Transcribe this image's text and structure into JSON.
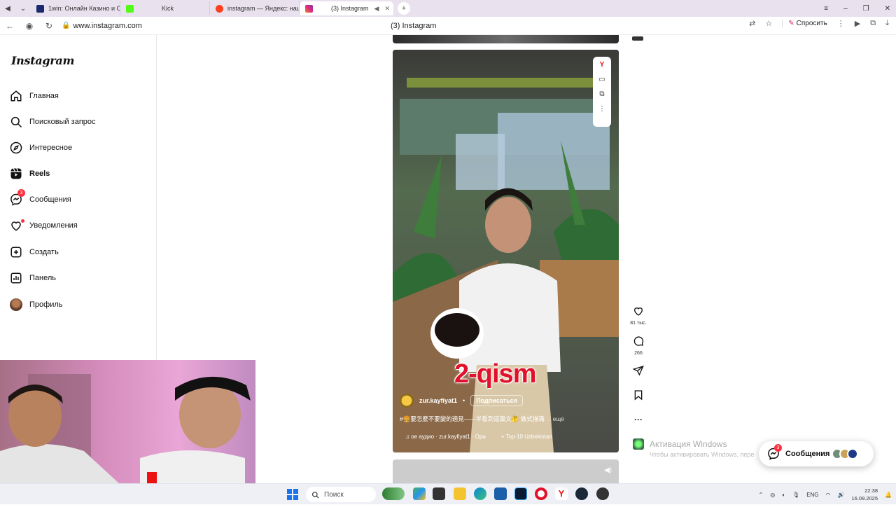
{
  "browser": {
    "tabs": [
      {
        "label": "1win: Онлайн Казино и С",
        "color": "#1a2a6c"
      },
      {
        "label": "Kick",
        "color": "#53fc18"
      },
      {
        "label": "instagram — Яндекс: наш",
        "color": "#fc3f1d"
      },
      {
        "label": "(3) Instagram",
        "color": "#e1306c",
        "active": true
      }
    ],
    "url": "www.instagram.com",
    "page_title": "(3) Instagram",
    "ask_label": "Спросить"
  },
  "sidebar": {
    "logo": "Instagram",
    "items": [
      {
        "label": "Главная",
        "icon": "home-icon"
      },
      {
        "label": "Поисковый запрос",
        "icon": "search-icon"
      },
      {
        "label": "Интересное",
        "icon": "compass-icon"
      },
      {
        "label": "Reels",
        "icon": "reels-icon",
        "active": true
      },
      {
        "label": "Сообщения",
        "icon": "messenger-icon",
        "badge": "3"
      },
      {
        "label": "Уведомления",
        "icon": "heart-icon"
      },
      {
        "label": "Создать",
        "icon": "plus-square-icon"
      },
      {
        "label": "Панель",
        "icon": "panel-icon"
      },
      {
        "label": "Профиль",
        "icon": "avatar"
      }
    ]
  },
  "reel": {
    "overlay_text": "2-qism",
    "username": "zur.kayfiyat1",
    "follow_label": "Подписаться",
    "description": "#🍔要怎麼不要變的適見——半看到這篇文🤔 做式描滿",
    "more_label": "... ещё",
    "audio_label": "ое аудио · zur.kayfiyat1 · Ори",
    "location_label": "Top-10 Uzbekistan",
    "likes": "81 тыс.",
    "comments": "266",
    "extension_icons": [
      "yandex-icon",
      "subtitles-icon",
      "picture-in-picture-icon",
      "more-vertical-icon"
    ]
  },
  "windows_activation": {
    "title": "Активация Windows",
    "subtitle": "Чтобы активировать Windows, пере"
  },
  "messages_pill": {
    "label": "Сообщения",
    "badge": "3",
    "avatar_colors": [
      "#6f8f7a",
      "#c9a35a",
      "#1d3a8a"
    ]
  },
  "taskbar": {
    "search_placeholder": "Поиск",
    "language": "ENG",
    "time": "22:38",
    "date": "16.09.2025"
  }
}
